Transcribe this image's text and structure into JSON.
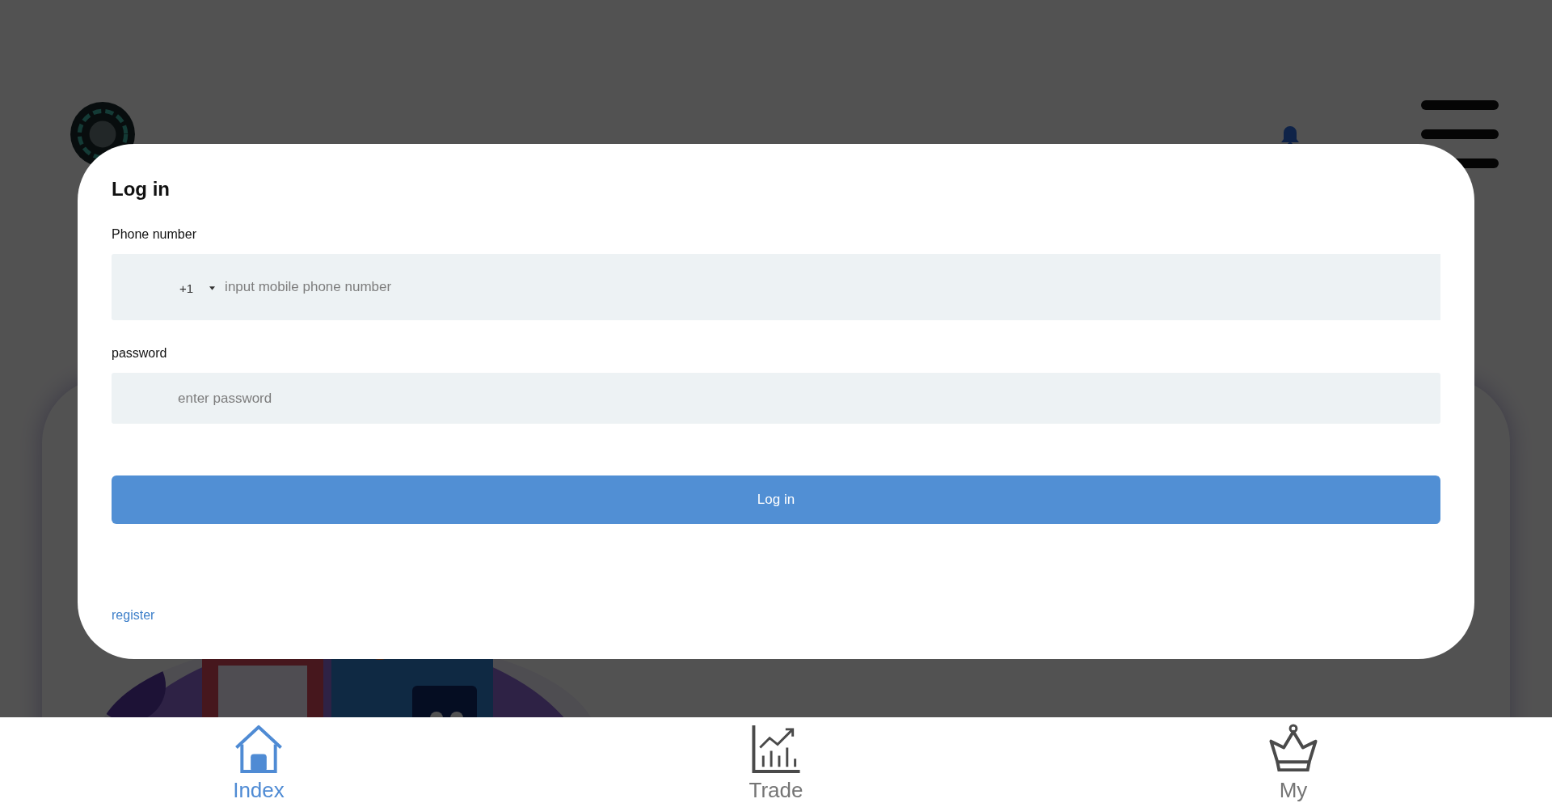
{
  "login": {
    "title": "Log in",
    "phone": {
      "label": "Phone number",
      "code": "+1",
      "placeholder": "input mobile phone number"
    },
    "password": {
      "label": "password",
      "placeholder": "enter password"
    },
    "submit": "Log in",
    "register": "register"
  },
  "nav": [
    {
      "label": "Index",
      "selected": true
    },
    {
      "label": "Trade",
      "selected": false
    },
    {
      "label": "My",
      "selected": false
    }
  ]
}
